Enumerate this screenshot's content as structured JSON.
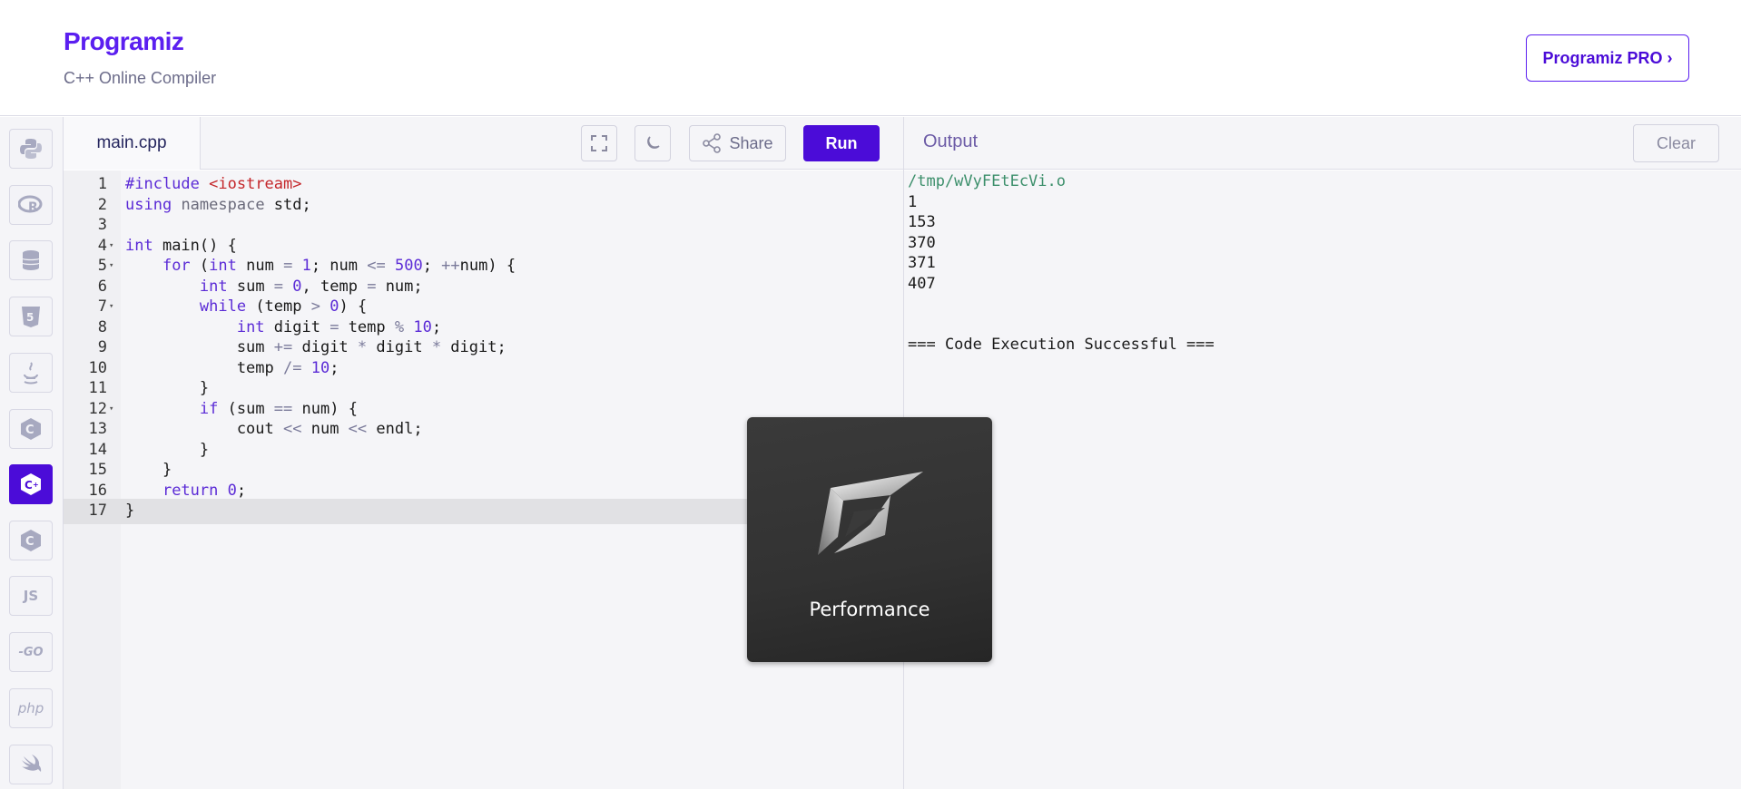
{
  "header": {
    "logo_text": "Programiz",
    "subtitle": "C++ Online Compiler",
    "pro_button": "Programiz PRO ›"
  },
  "languages": [
    {
      "name": "python",
      "icon": "python-icon"
    },
    {
      "name": "r",
      "icon": "r-icon"
    },
    {
      "name": "sql",
      "icon": "database-icon"
    },
    {
      "name": "html",
      "icon": "html5-icon"
    },
    {
      "name": "java",
      "icon": "java-icon"
    },
    {
      "name": "c",
      "icon": "c-icon"
    },
    {
      "name": "cpp",
      "icon": "cpp-icon",
      "active": true
    },
    {
      "name": "csharp",
      "icon": "csharp-icon"
    },
    {
      "name": "js",
      "label": "JS"
    },
    {
      "name": "go",
      "label": "-GO"
    },
    {
      "name": "php",
      "label": "php"
    },
    {
      "name": "swift",
      "icon": "swift-icon"
    }
  ],
  "editor": {
    "file_name": "main.cpp",
    "share_label": "Share",
    "run_label": "Run",
    "current_line": 17,
    "lines": [
      {
        "n": "1",
        "text": "#include <iostream>"
      },
      {
        "n": "2",
        "text": "using namespace std;"
      },
      {
        "n": "3",
        "text": ""
      },
      {
        "n": "4",
        "text": "int main() {",
        "fold": true
      },
      {
        "n": "5",
        "text": "    for (int num = 1; num <= 500; ++num) {",
        "fold": true
      },
      {
        "n": "6",
        "text": "        int sum = 0, temp = num;"
      },
      {
        "n": "7",
        "text": "        while (temp > 0) {",
        "fold": true
      },
      {
        "n": "8",
        "text": "            int digit = temp % 10;"
      },
      {
        "n": "9",
        "text": "            sum += digit * digit * digit;"
      },
      {
        "n": "10",
        "text": "            temp /= 10;"
      },
      {
        "n": "11",
        "text": "        }"
      },
      {
        "n": "12",
        "text": "        if (sum == num) {",
        "fold": true
      },
      {
        "n": "13",
        "text": "            cout << num << endl;"
      },
      {
        "n": "14",
        "text": "        }"
      },
      {
        "n": "15",
        "text": "    }"
      },
      {
        "n": "16",
        "text": "    return 0;"
      },
      {
        "n": "17",
        "text": "}"
      }
    ]
  },
  "output": {
    "title": "Output",
    "clear_label": "Clear",
    "lines": [
      "/tmp/wVyFEtEcVi.o",
      "1",
      "153",
      "370",
      "371",
      "407",
      "",
      "",
      "=== Code Execution Successful ==="
    ]
  },
  "overlay": {
    "label": "Performance"
  }
}
